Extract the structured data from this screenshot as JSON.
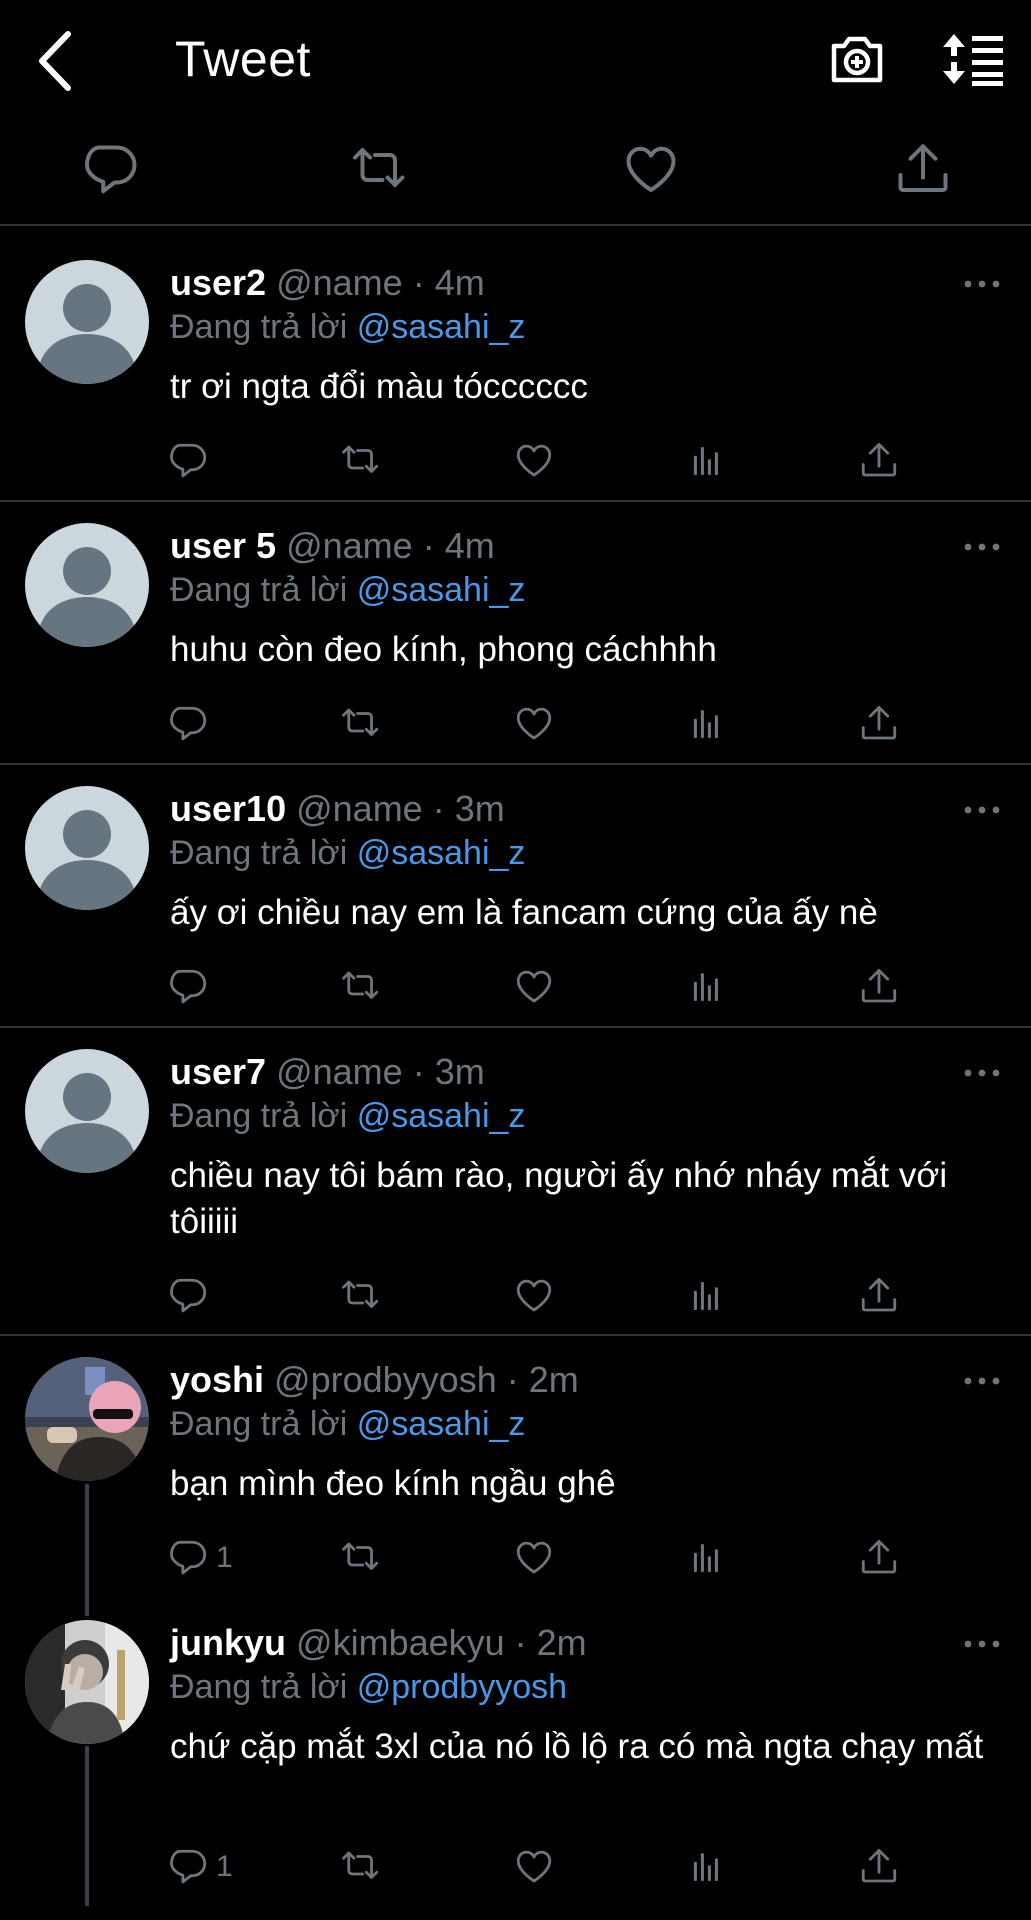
{
  "header": {
    "title": "Tweet"
  },
  "reply_prefix": "Đang trả lời",
  "tweets": [
    {
      "name": "user2",
      "handle": "@name",
      "time": "· 4m",
      "reply_to": "@sasahi_z",
      "text": "tr ơi ngta đổi màu tócccccc",
      "reply_count": ""
    },
    {
      "name": "user 5",
      "handle": "@name",
      "time": "· 4m",
      "reply_to": "@sasahi_z",
      "text": "huhu còn đeo kính, phong cáchhhh",
      "reply_count": ""
    },
    {
      "name": "user10",
      "handle": "@name",
      "time": "· 3m",
      "reply_to": "@sasahi_z",
      "text": "ấy ơi chiều nay em là fancam cứng của ấy nè",
      "reply_count": ""
    },
    {
      "name": "user7",
      "handle": "@name",
      "time": "· 3m",
      "reply_to": "@sasahi_z",
      "text": "chiều nay tôi bám rào, người ấy nhớ nháy mắt với tôiiiii",
      "reply_count": ""
    },
    {
      "name": "yoshi",
      "handle": "@prodbyyosh",
      "time": "· 2m",
      "reply_to": "@sasahi_z",
      "text": "bạn mình đeo kính ngầu ghê",
      "reply_count": "1"
    },
    {
      "name": "junkyu",
      "handle": "@kimbaekyu",
      "time": "· 2m",
      "reply_to": "@prodbyyosh",
      "text": "chứ cặp mắt 3xl của nó lồ lộ ra có mà ngta chạy mất",
      "reply_count": "1"
    }
  ],
  "colors": {
    "background": "#000000",
    "secondary_text": "#6e767d",
    "link": "#4a99e9",
    "divider": "#2f3336",
    "placeholder_avatar": "#ccd6dd"
  }
}
